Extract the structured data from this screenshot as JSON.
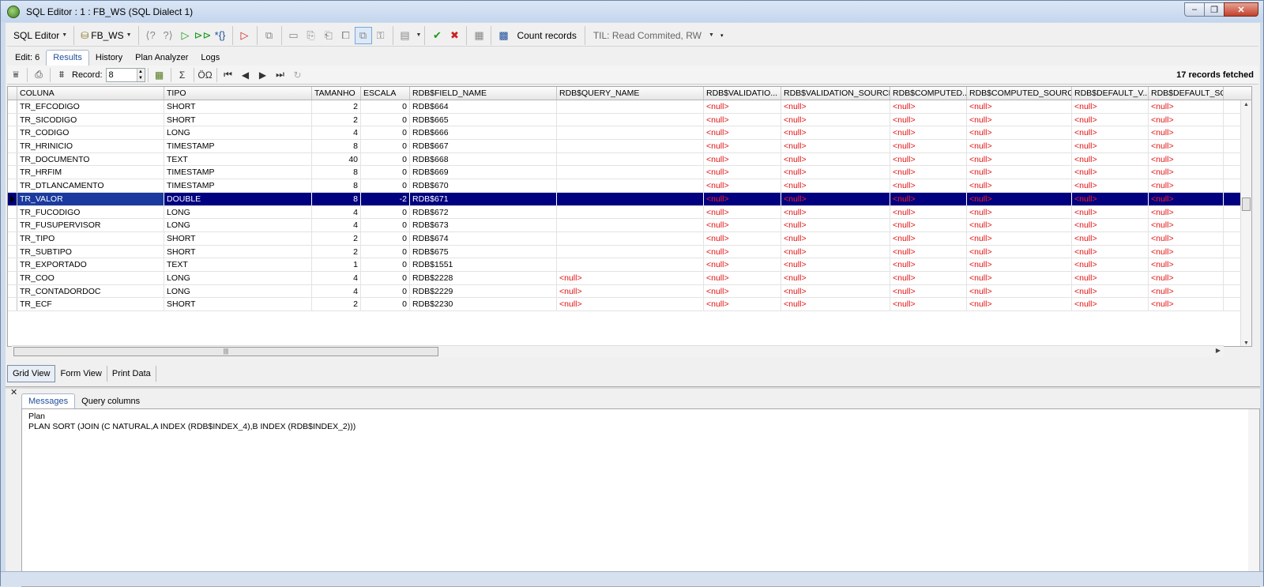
{
  "window": {
    "title": "SQL Editor : 1 : FB_WS (SQL Dialect 1)"
  },
  "toolbar": {
    "sql_editor_label": "SQL Editor",
    "database_label": "FB_WS",
    "count_records_label": "Count records",
    "til_label": "TIL: Read Commited, RW"
  },
  "tabs": [
    "Edit: 6",
    "Results",
    "History",
    "Plan Analyzer",
    "Logs"
  ],
  "record_nav": {
    "label": "Record:",
    "value": "8",
    "fetched": "17 records fetched"
  },
  "grid": {
    "columns": [
      "COLUNA",
      "TIPO",
      "TAMANHO",
      "ESCALA",
      "RDB$FIELD_NAME",
      "RDB$QUERY_NAME",
      "RDB$VALIDATIO...",
      "RDB$VALIDATION_SOURCE",
      "RDB$COMPUTED...",
      "RDB$COMPUTED_SOURCE",
      "RDB$DEFAULT_V...",
      "RDB$DEFAULT_SC"
    ],
    "rows": [
      [
        "TR_EFCODIGO",
        "SHORT",
        "2",
        "0",
        "RDB$664",
        "",
        "<null>",
        "<null>",
        "<null>",
        "<null>",
        "<null>",
        "<null>"
      ],
      [
        "TR_SICODIGO",
        "SHORT",
        "2",
        "0",
        "RDB$665",
        "",
        "<null>",
        "<null>",
        "<null>",
        "<null>",
        "<null>",
        "<null>"
      ],
      [
        "TR_CODIGO",
        "LONG",
        "4",
        "0",
        "RDB$666",
        "",
        "<null>",
        "<null>",
        "<null>",
        "<null>",
        "<null>",
        "<null>"
      ],
      [
        "TR_HRINICIO",
        "TIMESTAMP",
        "8",
        "0",
        "RDB$667",
        "",
        "<null>",
        "<null>",
        "<null>",
        "<null>",
        "<null>",
        "<null>"
      ],
      [
        "TR_DOCUMENTO",
        "TEXT",
        "40",
        "0",
        "RDB$668",
        "",
        "<null>",
        "<null>",
        "<null>",
        "<null>",
        "<null>",
        "<null>"
      ],
      [
        "TR_HRFIM",
        "TIMESTAMP",
        "8",
        "0",
        "RDB$669",
        "",
        "<null>",
        "<null>",
        "<null>",
        "<null>",
        "<null>",
        "<null>"
      ],
      [
        "TR_DTLANCAMENTO",
        "TIMESTAMP",
        "8",
        "0",
        "RDB$670",
        "",
        "<null>",
        "<null>",
        "<null>",
        "<null>",
        "<null>",
        "<null>"
      ],
      [
        "TR_VALOR",
        "DOUBLE",
        "8",
        "-2",
        "RDB$671",
        "",
        "<null>",
        "<null>",
        "<null>",
        "<null>",
        "<null>",
        "<null>"
      ],
      [
        "TR_FUCODIGO",
        "LONG",
        "4",
        "0",
        "RDB$672",
        "",
        "<null>",
        "<null>",
        "<null>",
        "<null>",
        "<null>",
        "<null>"
      ],
      [
        "TR_FUSUPERVISOR",
        "LONG",
        "4",
        "0",
        "RDB$673",
        "",
        "<null>",
        "<null>",
        "<null>",
        "<null>",
        "<null>",
        "<null>"
      ],
      [
        "TR_TIPO",
        "SHORT",
        "2",
        "0",
        "RDB$674",
        "",
        "<null>",
        "<null>",
        "<null>",
        "<null>",
        "<null>",
        "<null>"
      ],
      [
        "TR_SUBTIPO",
        "SHORT",
        "2",
        "0",
        "RDB$675",
        "",
        "<null>",
        "<null>",
        "<null>",
        "<null>",
        "<null>",
        "<null>"
      ],
      [
        "TR_EXPORTADO",
        "TEXT",
        "1",
        "0",
        "RDB$1551",
        "",
        "<null>",
        "<null>",
        "<null>",
        "<null>",
        "<null>",
        "<null>"
      ],
      [
        "TR_COO",
        "LONG",
        "4",
        "0",
        "RDB$2228",
        "<null>",
        "<null>",
        "<null>",
        "<null>",
        "<null>",
        "<null>",
        "<null>"
      ],
      [
        "TR_CONTADORDOC",
        "LONG",
        "4",
        "0",
        "RDB$2229",
        "<null>",
        "<null>",
        "<null>",
        "<null>",
        "<null>",
        "<null>",
        "<null>"
      ],
      [
        "TR_ECF",
        "SHORT",
        "2",
        "0",
        "RDB$2230",
        "<null>",
        "<null>",
        "<null>",
        "<null>",
        "<null>",
        "<null>",
        "<null>"
      ]
    ],
    "selected_row": 7
  },
  "view_tabs": [
    "Grid View",
    "Form View",
    "Print Data"
  ],
  "message_tabs": [
    "Messages",
    "Query columns"
  ],
  "messages": [
    "Plan",
    "PLAN SORT (JOIN (C NATURAL,A INDEX (RDB$INDEX_4),B INDEX (RDB$INDEX_2)))"
  ]
}
